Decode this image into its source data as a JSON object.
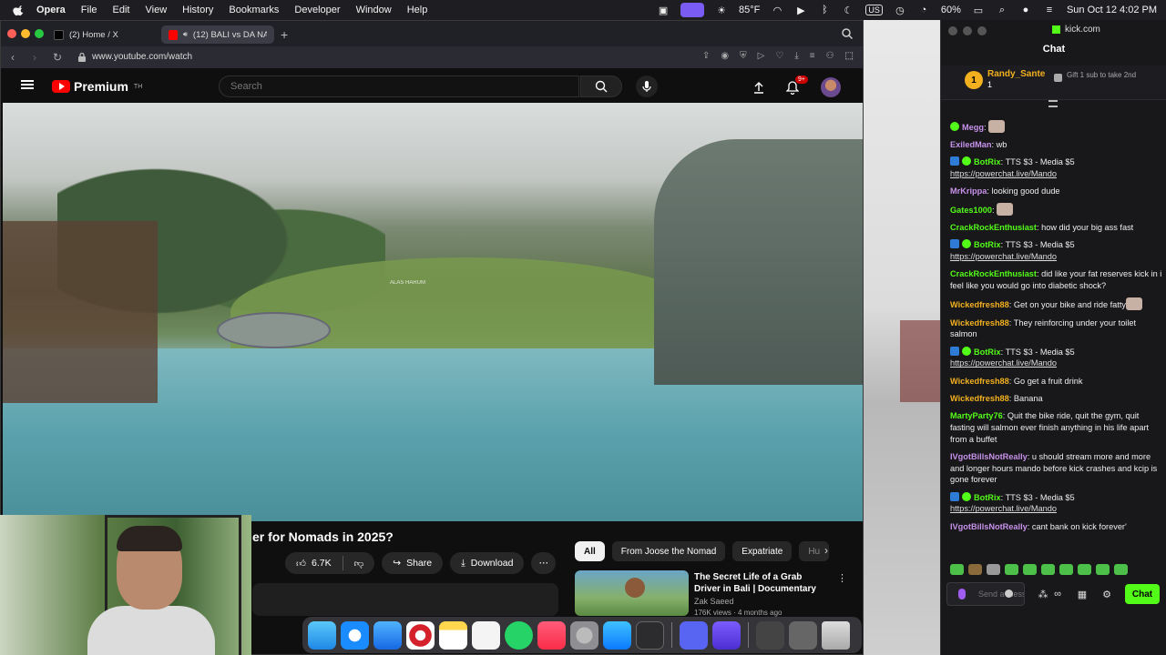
{
  "menubar": {
    "app": "Opera",
    "items": [
      "File",
      "Edit",
      "View",
      "History",
      "Bookmarks",
      "Developer",
      "Window",
      "Help"
    ],
    "temperature": "85°F",
    "battery": "60%",
    "keyboard": "US",
    "datetime": "Sun Oct 12  4:02 PM"
  },
  "browser": {
    "tabs": [
      {
        "label": "(2) Home / X"
      },
      {
        "label": "(12) BALI vs DA NAN"
      }
    ],
    "url": "www.youtube.com/watch"
  },
  "youtube": {
    "logo_text": "Premium",
    "logo_sup": "TH",
    "search_placeholder": "Search",
    "notification_count": "9+",
    "video_overlay_text": "ALAS HARUM",
    "video_title": "er for Nomads in 2025?",
    "like_count": "6.7K",
    "share_label": "Share",
    "download_label": "Download",
    "chips": [
      "All",
      "From Joose the Nomad",
      "Expatriate",
      "Hu"
    ],
    "recommendation": {
      "title": "The Secret Life of a Grab Driver in Bali | Documentary",
      "channel": "Zak Saeed",
      "meta": "176K views · 4 months ago"
    }
  },
  "kick": {
    "domain": "kick.com",
    "title": "Chat",
    "pinned": {
      "username": "Randy_Sante",
      "rank": "1",
      "count": "1",
      "gift_text": "Gift 1 sub to take 2nd"
    },
    "messages": [
      {
        "user": "Megg",
        "color": "#c792ea",
        "text": "",
        "badge": "ver",
        "emote": true,
        "link": ""
      },
      {
        "user": "ExiledMan",
        "color": "#c792ea",
        "text": "wb",
        "badge": "",
        "emote": false,
        "link": ""
      },
      {
        "user": "BotRix",
        "color": "#53fc18",
        "text": "TTS $3 - Media $5",
        "badge": "bot",
        "emote": false,
        "link": "https://powerchat.live/Mando"
      },
      {
        "user": "MrKrippa",
        "color": "#c792ea",
        "text": "looking good dude",
        "badge": "",
        "emote": false,
        "link": ""
      },
      {
        "user": "Gates1000",
        "color": "#53fc18",
        "text": "",
        "badge": "",
        "emote": true,
        "link": ""
      },
      {
        "user": "CrackRockEnthusiast",
        "color": "#53fc18",
        "text": "how did your big ass fast",
        "badge": "",
        "emote": false,
        "link": ""
      },
      {
        "user": "BotRix",
        "color": "#53fc18",
        "text": "TTS $3 - Media $5",
        "badge": "bot",
        "emote": false,
        "link": "https://powerchat.live/Mando"
      },
      {
        "user": "CrackRockEnthusiast",
        "color": "#53fc18",
        "text": "did like your fat reserves kick in i feel like you would go into diabetic shock?",
        "badge": "",
        "emote": false,
        "link": ""
      },
      {
        "user": "Wickedfresh88",
        "color": "#f2b01e",
        "text": "Get on your bike and ride fatty",
        "badge": "",
        "emote": true,
        "link": ""
      },
      {
        "user": "Wickedfresh88",
        "color": "#f2b01e",
        "text": "They reinforcing under your toilet salmon",
        "badge": "",
        "emote": false,
        "link": ""
      },
      {
        "user": "BotRix",
        "color": "#53fc18",
        "text": "TTS $3 - Media $5",
        "badge": "bot",
        "emote": false,
        "link": "https://powerchat.live/Mando"
      },
      {
        "user": "Wickedfresh88",
        "color": "#f2b01e",
        "text": "Go get a fruit drink",
        "badge": "",
        "emote": false,
        "link": ""
      },
      {
        "user": "Wickedfresh88",
        "color": "#f2b01e",
        "text": "Banana",
        "badge": "",
        "emote": false,
        "link": ""
      },
      {
        "user": "MartyParty76",
        "color": "#53fc18",
        "text": "Quit the bike ride, quit the gym, quit fasting will salmon ever finish anything in his life apart from a buffet",
        "badge": "",
        "emote": false,
        "link": ""
      },
      {
        "user": "IVgotBillsNotReally",
        "color": "#c792ea",
        "text": "u should stream more and more and longer hours mando before kick crashes and kcip is gone forever",
        "badge": "",
        "emote": false,
        "link": ""
      },
      {
        "user": "BotRix",
        "color": "#53fc18",
        "text": "TTS $3 - Media $5",
        "badge": "bot",
        "emote": false,
        "link": "https://powerchat.live/Mando"
      },
      {
        "user": "IVgotBillsNotReally",
        "color": "#c792ea",
        "text": "cant bank on kick forever'",
        "badge": "",
        "emote": false,
        "link": ""
      }
    ],
    "send_placeholder": "Send a message",
    "chat_button": "Chat"
  },
  "colors": {
    "kick_green": "#53fc18",
    "youtube_red": "#ff0000",
    "opera_red": "#d4212b"
  }
}
